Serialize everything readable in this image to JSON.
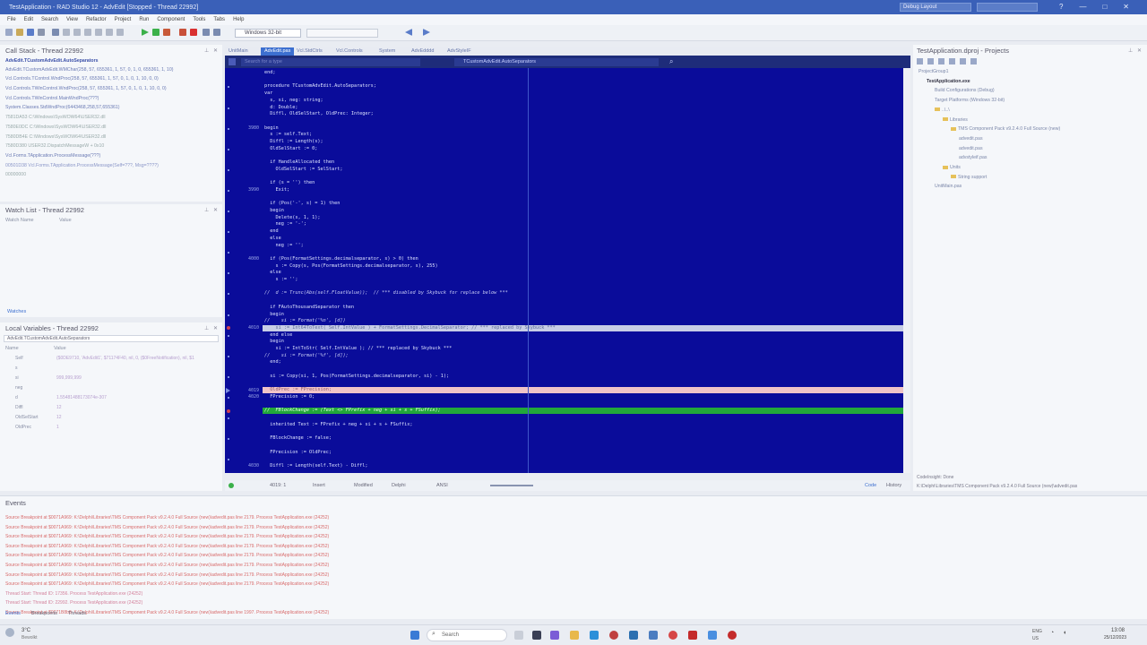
{
  "window": {
    "title": "TestApplication - RAD Studio 12 - AdvEdit [Stopped - Thread 22992]",
    "layout": "Debug Layout",
    "controls": [
      "—",
      "□",
      "✕"
    ]
  },
  "menu": [
    "File",
    "Edit",
    "Search",
    "View",
    "Refactor",
    "Project",
    "Run",
    "Component",
    "Tools",
    "Tabs",
    "Help"
  ],
  "toolbar": {
    "platform": "Windows 32-bit"
  },
  "callstack": {
    "title": "Call Stack - Thread 22992",
    "items": [
      "AdvEdit.TCustomAdvEdit.AutoSeparators",
      "AdvEdit.TCustomAdvEdit.WMChar(258, 57, 655361, 1, 57, 0, 1, 0, 655361, 1, 10)",
      "Vcl.Controls.TControl.WndProc(258, 57, 655361, 1, 57, 0, 1, 0, 1, 10, 0, 0)",
      "Vcl.Controls.TWinControl.WndProc(258, 57, 655361, 1, 57, 0, 1, 0, 1, 10, 0, 0)",
      "Vcl.Controls.TWinControl.MainWndProc(???)",
      "System.Classes.StdWndProc(6443468,258,57,655361)",
      "7581DA53 C:\\Windows\\SysWOW64\\USER32.dll",
      "7580E0DC C:\\Windows\\SysWOW64\\USER32.dll",
      "7580DB4E C:\\Windows\\SysWOW64\\USER32.dll",
      "7580D380 USER32.DispatchMessageW + 0x10",
      "Vcl.Forms.TApplication.ProcessMessage(???)",
      "00501D38 Vcl.Forms.TApplication.ProcessMessage(Self=???, Msg=????)",
      "00000000"
    ]
  },
  "watch": {
    "title": "Watch List - Thread 22992",
    "headers": [
      "Watch Name",
      "Value"
    ],
    "tab": "Watches"
  },
  "locals": {
    "title": "Local Variables - Thread 22992",
    "context": "AdvEdit.TCustomAdvEdit.AutoSeparators",
    "headers": [
      "Name",
      "Value"
    ],
    "rows": [
      {
        "name": "Self",
        "value": "($0DE9710, 'AdvEdit1', $71174F40, nil, 0, ($0FreeNotification), nil, $1"
      },
      {
        "name": "s",
        "value": ""
      },
      {
        "name": "si",
        "value": "999,999,999"
      },
      {
        "name": "neg",
        "value": ""
      },
      {
        "name": "d",
        "value": "1.55481488173074e-307"
      },
      {
        "name": "Diffl",
        "value": "12"
      },
      {
        "name": "OldSelStart",
        "value": "12"
      },
      {
        "name": "OldPrec",
        "value": "1"
      }
    ]
  },
  "editor": {
    "tabs": [
      "UnitMain",
      "AdvEdit.pas",
      "Vcl.StdCtrls",
      "Vcl.Controls",
      "System",
      "AdvEdddd",
      "AdvStyleIF"
    ],
    "active_tab": 1,
    "symbol_placeholder": "Search for a type",
    "method_combo": "TCustomAdvEdit.AutoSeparators",
    "line_numbers": [
      {
        "n": "3980",
        "row": 8
      },
      {
        "n": "3990",
        "row": 17
      },
      {
        "n": "4000",
        "row": 27
      },
      {
        "n": "4010",
        "row": 37
      },
      {
        "n": "4019",
        "row": 46
      },
      {
        "n": "4020",
        "row": 47
      },
      {
        "n": "4030",
        "row": 57
      }
    ],
    "lines": [
      {
        "row": 0,
        "text": "end;"
      },
      {
        "row": 2,
        "text": "procedure TCustomAdvEdit.AutoSeparators;"
      },
      {
        "row": 3,
        "text": "var"
      },
      {
        "row": 4,
        "text": "  s, si, neg: string;"
      },
      {
        "row": 5,
        "text": "  d: Double;"
      },
      {
        "row": 6,
        "text": "  Diffl, OldSelStart, OldPrec: Integer;"
      },
      {
        "row": 8,
        "text": "begin"
      },
      {
        "row": 9,
        "text": "  s := self.Text;"
      },
      {
        "row": 10,
        "text": "  Diffl := Length(s);"
      },
      {
        "row": 11,
        "text": "  OldSelStart := 0;"
      },
      {
        "row": 13,
        "text": "  if HandleAllocated then"
      },
      {
        "row": 14,
        "text": "    OldSelStart := SelStart;"
      },
      {
        "row": 16,
        "text": "  if (s = '') then"
      },
      {
        "row": 17,
        "text": "    Exit;"
      },
      {
        "row": 19,
        "text": "  if (Pos('-', s) = 1) then"
      },
      {
        "row": 20,
        "text": "  begin"
      },
      {
        "row": 21,
        "text": "    Delete(s, 1, 1);"
      },
      {
        "row": 22,
        "text": "    neg := '-';"
      },
      {
        "row": 23,
        "text": "  end"
      },
      {
        "row": 24,
        "text": "  else"
      },
      {
        "row": 25,
        "text": "    neg := '';"
      },
      {
        "row": 27,
        "text": "  if (Pos(FormatSettings.decimalseparator, s) > 0) then"
      },
      {
        "row": 28,
        "text": "    s := Copy(s, Pos(FormatSettings.decimalseparator, s), 255)"
      },
      {
        "row": 29,
        "text": "  else"
      },
      {
        "row": 30,
        "text": "    s := '';"
      },
      {
        "row": 32,
        "text": "//  d := Trunc(Abs(self.FloatValue));  // *** disabled by Skybuck for replace below ***",
        "comment": true
      },
      {
        "row": 34,
        "text": "  if FAutoThousandSeparator then"
      },
      {
        "row": 35,
        "text": "  begin"
      },
      {
        "row": 36,
        "text": "//    si := Format('%n', [d])",
        "comment": true
      },
      {
        "row": 37,
        "text": "    si := Int64ToText( Self.IntValue ) + FormatSettings.DecimalSeparator; // *** replaced by Skybuck ***"
      },
      {
        "row": 38,
        "text": "  end else"
      },
      {
        "row": 39,
        "text": "  begin"
      },
      {
        "row": 40,
        "text": "    si := IntToStr( Self.IntValue ); // *** replaced by Skybuck ***"
      },
      {
        "row": 41,
        "text": "//    si := Format('%f', [d]);",
        "comment": true
      },
      {
        "row": 42,
        "text": "  end;"
      },
      {
        "row": 44,
        "text": "  si := Copy(si, 1, Pos(FormatSettings.decimalseparator, si) - 1);"
      },
      {
        "row": 46,
        "text": "  OldPrec := FPrecision;"
      },
      {
        "row": 47,
        "text": "  FPrecision := 0;"
      },
      {
        "row": 49,
        "text": "//  FBlockChange := (Text <> FPrefix + neg + si + s + FSuffix);",
        "comment": true
      },
      {
        "row": 51,
        "text": "  inherited Text := FPrefix + neg + si + s + FSuffix;"
      },
      {
        "row": 53,
        "text": "  FBlockChange := false;"
      },
      {
        "row": 55,
        "text": "  FPrecision := OldPrec;"
      },
      {
        "row": 57,
        "text": "  Diffl := Length(self.Text) - Diffl;"
      }
    ]
  },
  "statusbar": {
    "position": "4019: 1",
    "mode": "Insert",
    "modified": "Modified",
    "language": "Delphi",
    "encoding": "ANSI",
    "tabs": [
      "Code",
      "History"
    ]
  },
  "projects": {
    "title": "TestApplication.dproj - Projects",
    "tree": [
      {
        "label": "ProjectGroup1",
        "indent": 0,
        "folder": false
      },
      {
        "label": "TestApplication.exe",
        "indent": 1,
        "folder": false,
        "bold": true
      },
      {
        "label": "Build Configurations (Debug)",
        "indent": 2,
        "folder": false
      },
      {
        "label": "Target Platforms (Windows 32-bit)",
        "indent": 2,
        "folder": false
      },
      {
        "label": "..\\..\\",
        "indent": 2,
        "folder": true
      },
      {
        "label": "Libraries",
        "indent": 3,
        "folder": true
      },
      {
        "label": "TMS Component Pack v9.2.4.0 Full Source (new)",
        "indent": 4,
        "folder": true
      },
      {
        "label": "advedit.pas",
        "indent": 5,
        "folder": false
      },
      {
        "label": "advedit.pas",
        "indent": 5,
        "folder": false
      },
      {
        "label": "advstyleif.pas",
        "indent": 5,
        "folder": false
      },
      {
        "label": "Units",
        "indent": 3,
        "folder": true
      },
      {
        "label": "String support",
        "indent": 4,
        "folder": true
      },
      {
        "label": "UnitMain.pas",
        "indent": 2,
        "folder": false
      }
    ],
    "footer": [
      "CodeInsight: Done",
      "K:\\Delphi\\Libraries\\TMS Component Pack v9.2.4.0 Full Source (new)\\advedit.pas"
    ]
  },
  "events": {
    "title": "Events",
    "lines": [
      "Source Breakpoint at $0071A969: K:\\Delphi\\Libraries\\TMS Component Pack v9.2.4.0 Full Source (new)\\advedit.pas line 2179. Process TestApplication.exe (24252)",
      "Source Breakpoint at $0071A969: K:\\Delphi\\Libraries\\TMS Component Pack v9.2.4.0 Full Source (new)\\advedit.pas line 2179. Process TestApplication.exe (24252)",
      "Source Breakpoint at $0071A969: K:\\Delphi\\Libraries\\TMS Component Pack v9.2.4.0 Full Source (new)\\advedit.pas line 2179. Process TestApplication.exe (24252)",
      "Source Breakpoint at $0071A969: K:\\Delphi\\Libraries\\TMS Component Pack v9.2.4.0 Full Source (new)\\advedit.pas line 2179. Process TestApplication.exe (24252)",
      "Source Breakpoint at $0071A969: K:\\Delphi\\Libraries\\TMS Component Pack v9.2.4.0 Full Source (new)\\advedit.pas line 2179. Process TestApplication.exe (24252)",
      "Source Breakpoint at $0071A969: K:\\Delphi\\Libraries\\TMS Component Pack v9.2.4.0 Full Source (new)\\advedit.pas line 2179. Process TestApplication.exe (24252)",
      "Source Breakpoint at $0071A969: K:\\Delphi\\Libraries\\TMS Component Pack v9.2.4.0 Full Source (new)\\advedit.pas line 2179. Process TestApplication.exe (24252)",
      "Source Breakpoint at $0071A969: K:\\Delphi\\Libraries\\TMS Component Pack v9.2.4.0 Full Source (new)\\advedit.pas line 2179. Process TestApplication.exe (24252)",
      "Thread Start: Thread ID: 17356. Process TestApplication.exe (24252)",
      "Thread Start: Thread ID: 22992. Process TestApplication.exe (24252)",
      "Source Breakpoint at $0071B8b8: K:\\Delphi\\Libraries\\TMS Component Pack v9.2.4.0 Full Source (new)\\advedit.pas line 1997. Process TestApplication.exe (24252)"
    ],
    "tabs": [
      "Events",
      "Breakpoints",
      "Threads"
    ]
  },
  "taskbar": {
    "weather_temp": "3°C",
    "weather_text": "Bewolkt",
    "search": "Search",
    "lang": [
      "ENG",
      "US"
    ],
    "time": "13:08",
    "date": "25/12/2023"
  },
  "colors": {
    "editor_bg": "#0a0c9a",
    "highlight_line": "#c7cde6",
    "exec_line": "#f0c4c8",
    "breakpoint_line": "#22a83a",
    "titlebar": "#3a60b8"
  }
}
